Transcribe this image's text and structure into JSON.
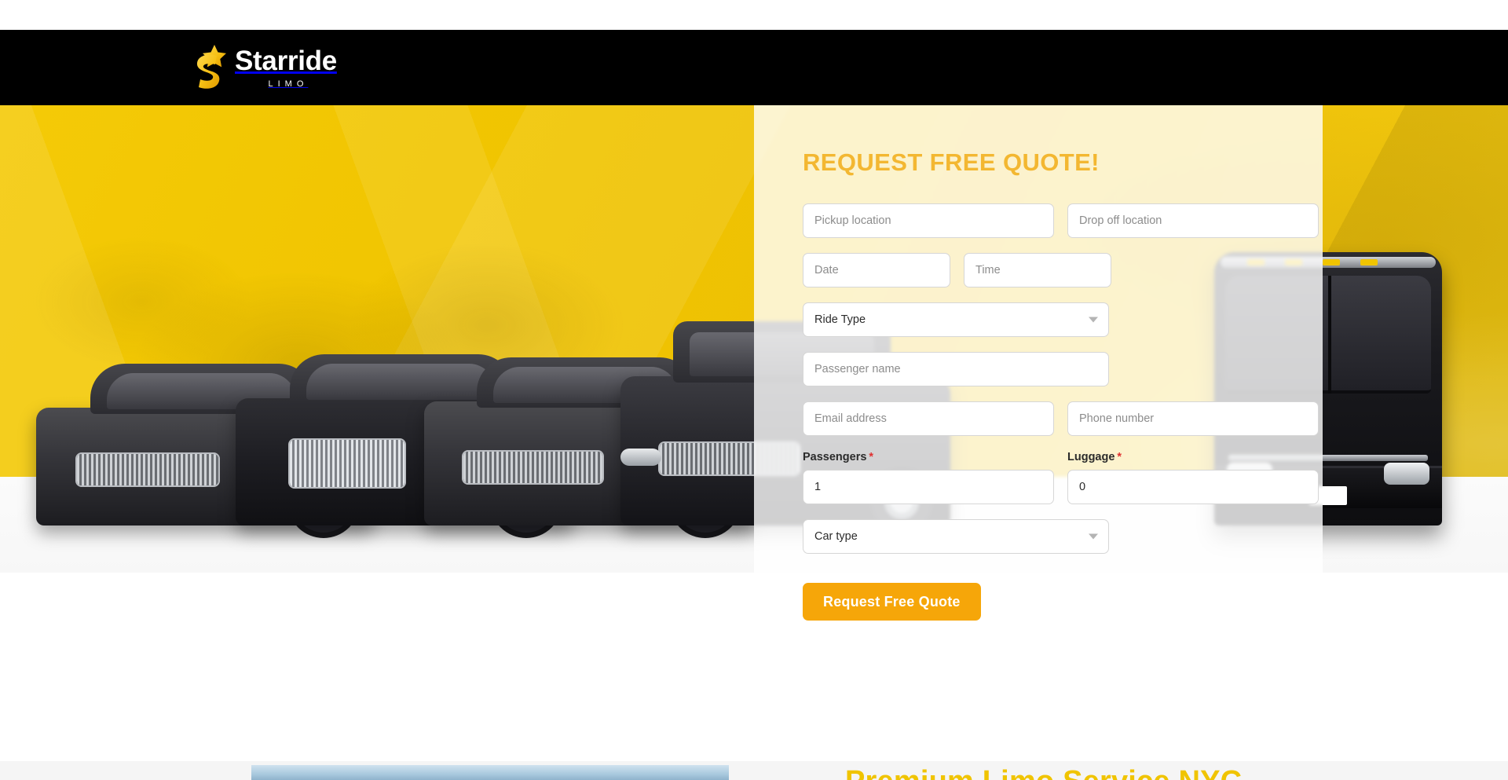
{
  "brand": {
    "name": "Starride",
    "subtitle": "LIMO",
    "logo_icon": "star-s-logo-icon",
    "bar_color": "#000000",
    "accent_color": "#F0C400"
  },
  "hero": {
    "background_color": "#F0C400",
    "vehicles_alt": "black luxury sedans and limo bus fleet"
  },
  "quote_form": {
    "title": "REQUEST FREE QUOTE!",
    "title_color": "#F3B731",
    "pickup": {
      "placeholder": "Pickup location",
      "value": ""
    },
    "dropoff": {
      "placeholder": "Drop off location",
      "value": ""
    },
    "date": {
      "placeholder": "Date",
      "value": ""
    },
    "time": {
      "placeholder": "Time",
      "value": ""
    },
    "ride_type": {
      "placeholder": "Ride Type",
      "value": "Ride Type",
      "caret_icon": "chevron-down-icon"
    },
    "passenger_name": {
      "placeholder": "Passenger name",
      "value": ""
    },
    "email": {
      "placeholder": "Email address",
      "value": ""
    },
    "phone": {
      "placeholder": "Phone number",
      "value": ""
    },
    "passengers": {
      "label": "Passengers",
      "required_mark": "*",
      "value": "1"
    },
    "luggage": {
      "label": "Luggage",
      "required_mark": "*",
      "value": "0"
    },
    "car_type": {
      "placeholder": "Car type",
      "value": "Car type",
      "caret_icon": "chevron-down-icon"
    },
    "submit_label": "Request Free Quote",
    "submit_color": "#F6A609"
  },
  "next_section": {
    "heading": "Premium Limo Service NYC",
    "heading_color": "#F0C400"
  }
}
